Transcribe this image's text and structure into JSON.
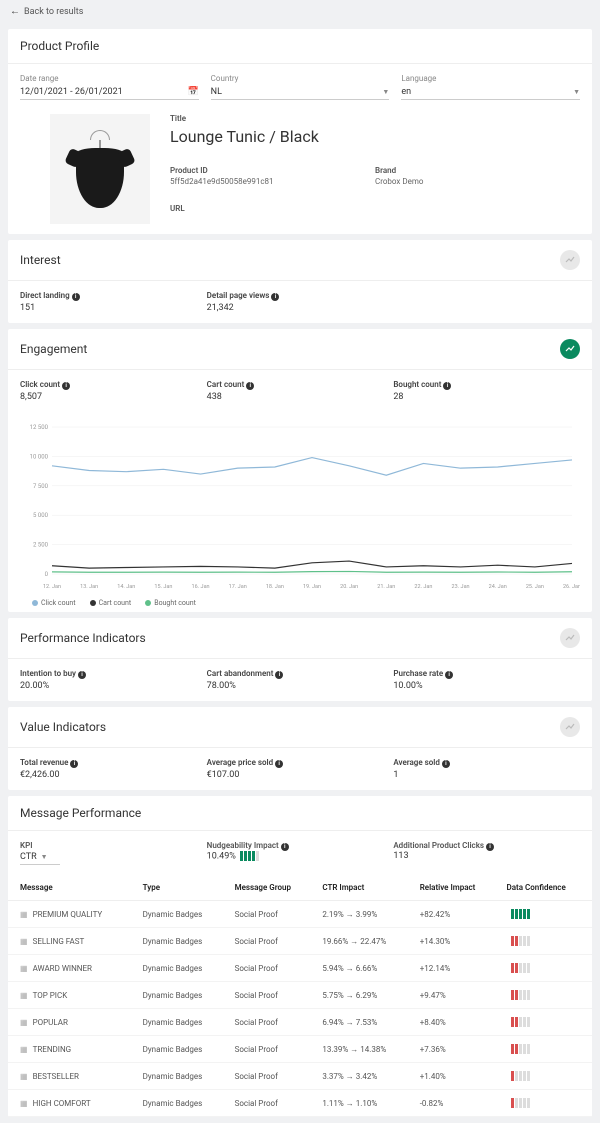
{
  "back": "Back to results",
  "profile": {
    "title": "Product Profile",
    "dateRange": {
      "label": "Date range",
      "value": "12/01/2021 - 26/01/2021"
    },
    "country": {
      "label": "Country",
      "value": "NL"
    },
    "language": {
      "label": "Language",
      "value": "en"
    },
    "productTitleLabel": "Title",
    "productTitle": "Lounge Tunic / Black",
    "productIdLabel": "Product ID",
    "productId": "5ff5d2a41e9d50058e991c81",
    "brandLabel": "Brand",
    "brand": "Crobox Demo",
    "urlLabel": "URL"
  },
  "interest": {
    "title": "Interest",
    "directLanding": {
      "label": "Direct landing",
      "value": "151"
    },
    "detailViews": {
      "label": "Detail page views",
      "value": "21,342"
    }
  },
  "engagement": {
    "title": "Engagement",
    "clickCount": {
      "label": "Click count",
      "value": "8,507"
    },
    "cartCount": {
      "label": "Cart count",
      "value": "438"
    },
    "boughtCount": {
      "label": "Bought count",
      "value": "28"
    },
    "legend": {
      "click": "Click count",
      "cart": "Cart count",
      "bought": "Bought count"
    }
  },
  "chart_data": {
    "type": "line",
    "x": [
      "12. Jan",
      "13. Jan",
      "14. Jan",
      "15. Jan",
      "16. Jan",
      "17. Jan",
      "18. Jan",
      "19. Jan",
      "20. Jan",
      "21. Jan",
      "22. Jan",
      "23. Jan",
      "24. Jan",
      "25. Jan",
      "26. Jan"
    ],
    "series": [
      {
        "name": "Click count",
        "color": "#8fb8d8",
        "values": [
          9200,
          8800,
          8700,
          8900,
          8500,
          9000,
          9100,
          9900,
          9200,
          8400,
          9400,
          9000,
          9100,
          9400,
          9700
        ]
      },
      {
        "name": "Cart count",
        "color": "#333333",
        "values": [
          700,
          500,
          550,
          600,
          650,
          600,
          500,
          950,
          1100,
          600,
          700,
          600,
          750,
          600,
          900
        ]
      },
      {
        "name": "Bought count",
        "color": "#5fc08a",
        "values": [
          180,
          150,
          150,
          160,
          150,
          160,
          150,
          200,
          220,
          150,
          160,
          150,
          170,
          150,
          190
        ]
      }
    ],
    "ylim": [
      0,
      12500
    ],
    "yTicks": [
      "0",
      "2 500",
      "5 000",
      "7 500",
      "10 000",
      "12 500"
    ]
  },
  "performance": {
    "title": "Performance Indicators",
    "intention": {
      "label": "Intention to buy",
      "value": "20.00%"
    },
    "abandonment": {
      "label": "Cart abandonment",
      "value": "78.00%"
    },
    "purchase": {
      "label": "Purchase rate",
      "value": "10.00%"
    }
  },
  "valueInd": {
    "title": "Value Indicators",
    "revenue": {
      "label": "Total revenue",
      "value": "€2,426.00"
    },
    "avgPrice": {
      "label": "Average price sold",
      "value": "€107.00"
    },
    "avgSold": {
      "label": "Average sold",
      "value": "1"
    }
  },
  "msgPerf": {
    "title": "Message Performance",
    "kpiLabel": "KPI",
    "kpiValue": "CTR",
    "nudge": {
      "label": "Nudgeability Impact",
      "value": "10.49%"
    },
    "clicks": {
      "label": "Additional Product Clicks",
      "value": "113"
    },
    "headers": {
      "message": "Message",
      "type": "Type",
      "group": "Message Group",
      "ctr": "CTR Impact",
      "rel": "Relative Impact",
      "conf": "Data Confidence"
    },
    "rows": [
      {
        "message": "PREMIUM QUALITY",
        "type": "Dynamic Badges",
        "group": "Social Proof",
        "ctr": "2.19% → 3.99%",
        "rel": "+82.42%",
        "conf": "green5"
      },
      {
        "message": "SELLING FAST",
        "type": "Dynamic Badges",
        "group": "Social Proof",
        "ctr": "19.66% → 22.47%",
        "rel": "+14.30%",
        "conf": "red2"
      },
      {
        "message": "AWARD WINNER",
        "type": "Dynamic Badges",
        "group": "Social Proof",
        "ctr": "5.94% → 6.66%",
        "rel": "+12.14%",
        "conf": "red2"
      },
      {
        "message": "TOP PICK",
        "type": "Dynamic Badges",
        "group": "Social Proof",
        "ctr": "5.75% → 6.29%",
        "rel": "+9.47%",
        "conf": "red2"
      },
      {
        "message": "POPULAR",
        "type": "Dynamic Badges",
        "group": "Social Proof",
        "ctr": "6.94% → 7.53%",
        "rel": "+8.40%",
        "conf": "red2"
      },
      {
        "message": "TRENDING",
        "type": "Dynamic Badges",
        "group": "Social Proof",
        "ctr": "13.39% → 14.38%",
        "rel": "+7.36%",
        "conf": "red2"
      },
      {
        "message": "BESTSELLER",
        "type": "Dynamic Badges",
        "group": "Social Proof",
        "ctr": "3.37% → 3.42%",
        "rel": "+1.40%",
        "conf": "red1"
      },
      {
        "message": "HIGH COMFORT",
        "type": "Dynamic Badges",
        "group": "Social Proof",
        "ctr": "1.11% → 1.10%",
        "rel": "-0.82%",
        "conf": "red1"
      }
    ]
  }
}
